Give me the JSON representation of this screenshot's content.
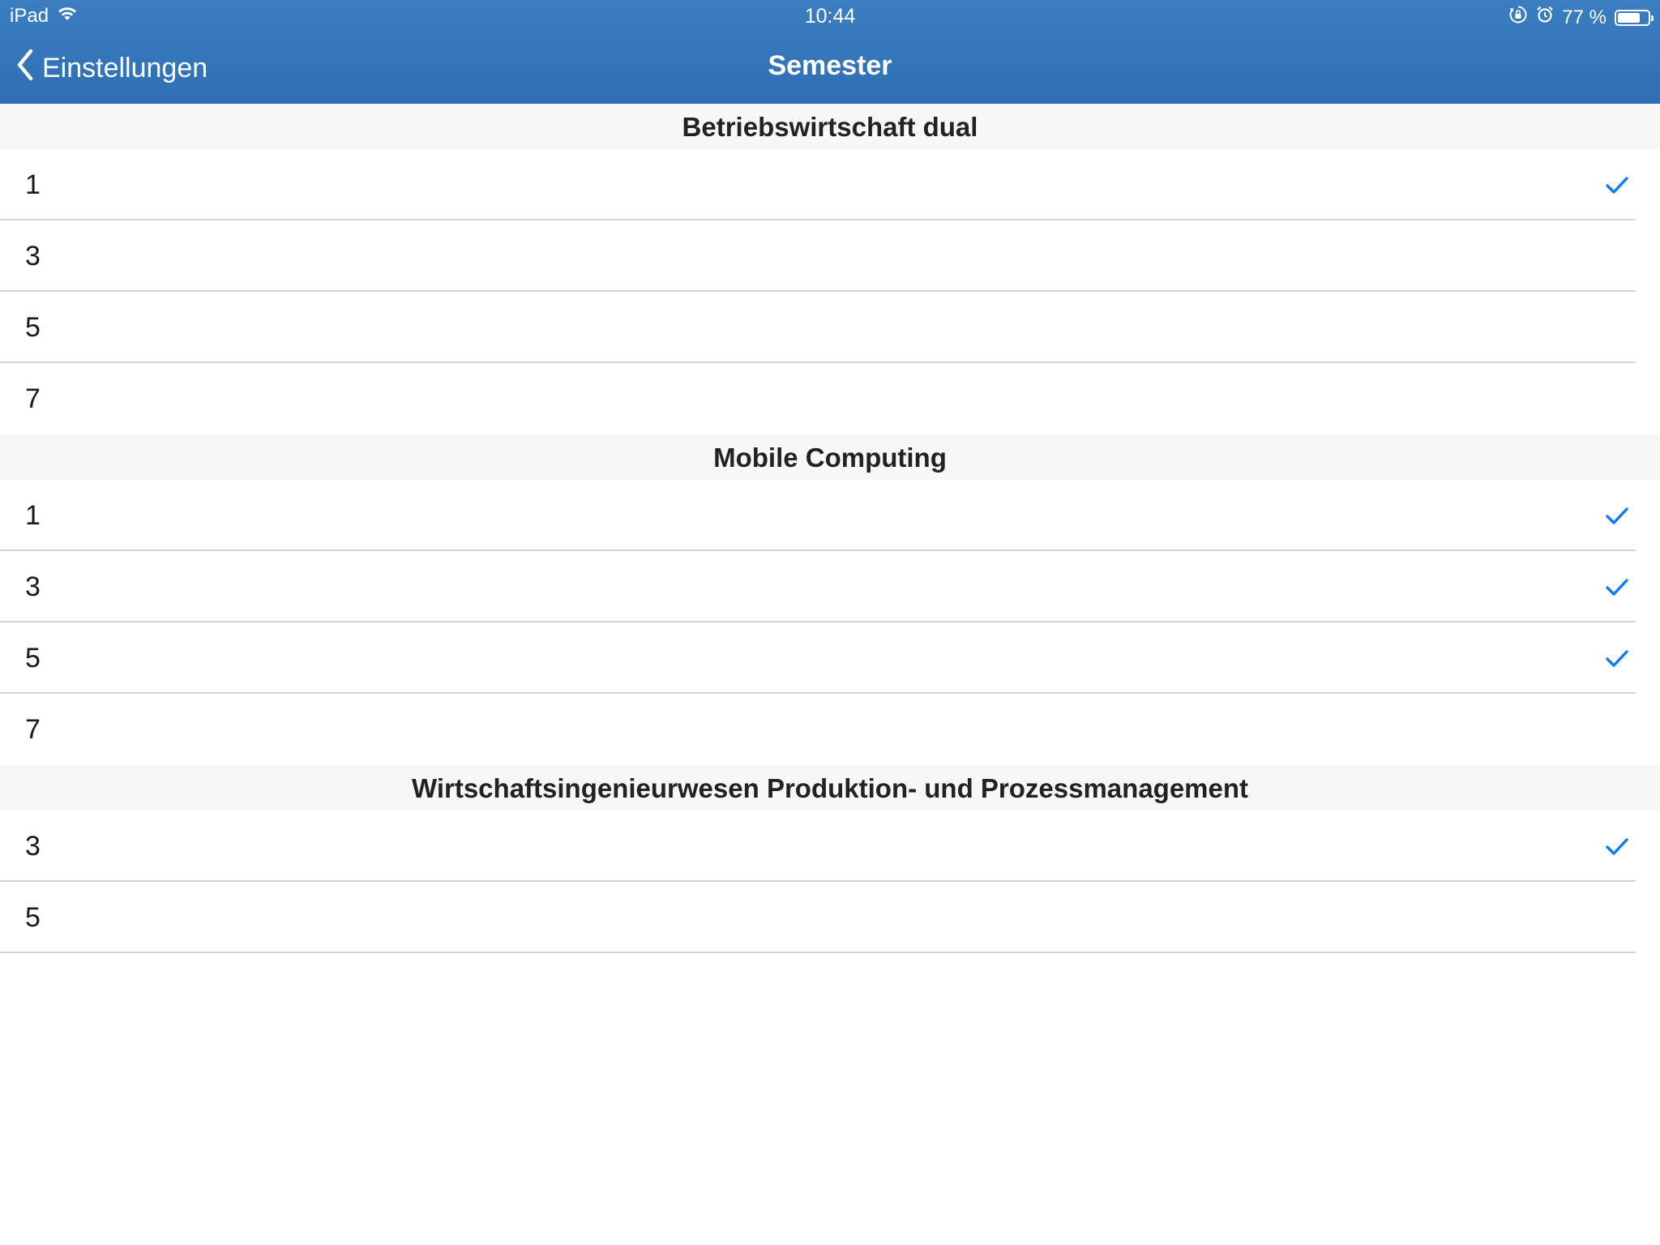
{
  "status_bar": {
    "device": "iPad",
    "time": "10:44",
    "battery": "77 %",
    "battery_level": 0.77,
    "icons": [
      "wifi-icon",
      "orientation-lock-icon",
      "alarm-icon",
      "battery-icon"
    ]
  },
  "nav": {
    "back_label": "Einstellungen",
    "title": "Semester"
  },
  "colors": {
    "header": "#3177bb",
    "accent": "#0a7aff",
    "section_bg": "#f7f7f7"
  },
  "sections": [
    {
      "title": "Betriebswirtschaft dual",
      "rows": [
        {
          "label": "1",
          "checked": true
        },
        {
          "label": "3",
          "checked": false
        },
        {
          "label": "5",
          "checked": false
        },
        {
          "label": "7",
          "checked": false
        }
      ]
    },
    {
      "title": "Mobile Computing",
      "rows": [
        {
          "label": "1",
          "checked": true
        },
        {
          "label": "3",
          "checked": true
        },
        {
          "label": "5",
          "checked": true
        },
        {
          "label": "7",
          "checked": false
        }
      ]
    },
    {
      "title": "Wirtschaftsingenieurwesen Produktion- und Prozessmanagement",
      "rows": [
        {
          "label": "3",
          "checked": true
        },
        {
          "label": "5",
          "checked": false
        }
      ]
    }
  ]
}
